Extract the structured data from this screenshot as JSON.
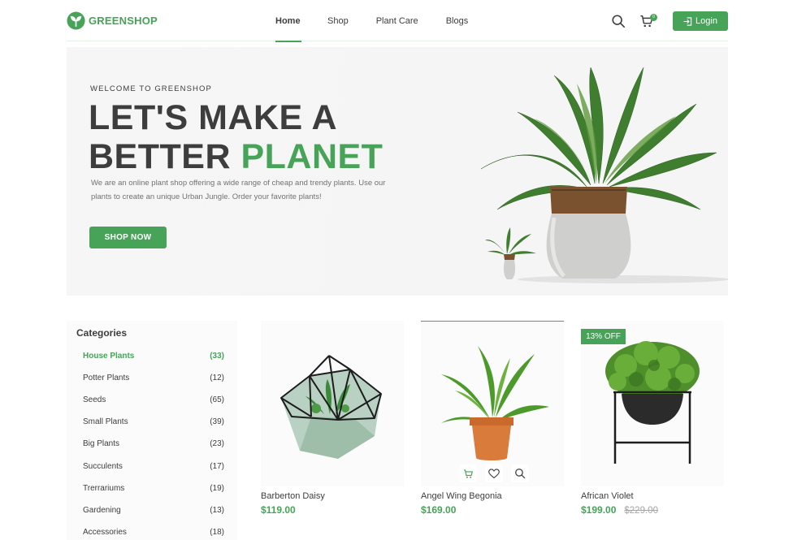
{
  "header": {
    "logo_text": "GREENSHOP",
    "nav": [
      "Home",
      "Shop",
      "Plant Care",
      "Blogs"
    ],
    "cart_count": "0",
    "login_label": "Login"
  },
  "hero": {
    "eyebrow": "WELCOME TO GREENSHOP",
    "title_line1": "LET'S MAKE A",
    "title_line2_dark": "BETTER ",
    "title_line2_green": "PLANET",
    "description": "We are an online plant shop offering a wide range of cheap and trendy plants. Use our plants to create an unique Urban Jungle. Order your favorite plants!",
    "cta_label": "SHOP NOW"
  },
  "categories": {
    "title": "Categories",
    "items": [
      {
        "label": "House Plants",
        "count": "(33)"
      },
      {
        "label": "Potter Plants",
        "count": "(12)"
      },
      {
        "label": "Seeds",
        "count": "(65)"
      },
      {
        "label": "Small Plants",
        "count": "(39)"
      },
      {
        "label": "Big Plants",
        "count": "(23)"
      },
      {
        "label": "Succulents",
        "count": "(17)"
      },
      {
        "label": "Trerrariums",
        "count": "(19)"
      },
      {
        "label": "Gardening",
        "count": "(13)"
      },
      {
        "label": "Accessories",
        "count": "(18)"
      }
    ]
  },
  "products": [
    {
      "name": "Barberton Daisy",
      "price": "$119.00"
    },
    {
      "name": "Angel Wing Begonia",
      "price": "$169.00"
    },
    {
      "name": "African Violet",
      "price": "$199.00",
      "old_price": "$229.00",
      "badge": "13% OFF"
    }
  ],
  "colors": {
    "accent": "#46a358",
    "text": "#3d3d3d",
    "muted": "#727272",
    "panel": "#f6f6f6"
  },
  "icons": [
    "leaf-logo-icon",
    "search-icon",
    "cart-icon",
    "login-icon",
    "heart-icon"
  ]
}
